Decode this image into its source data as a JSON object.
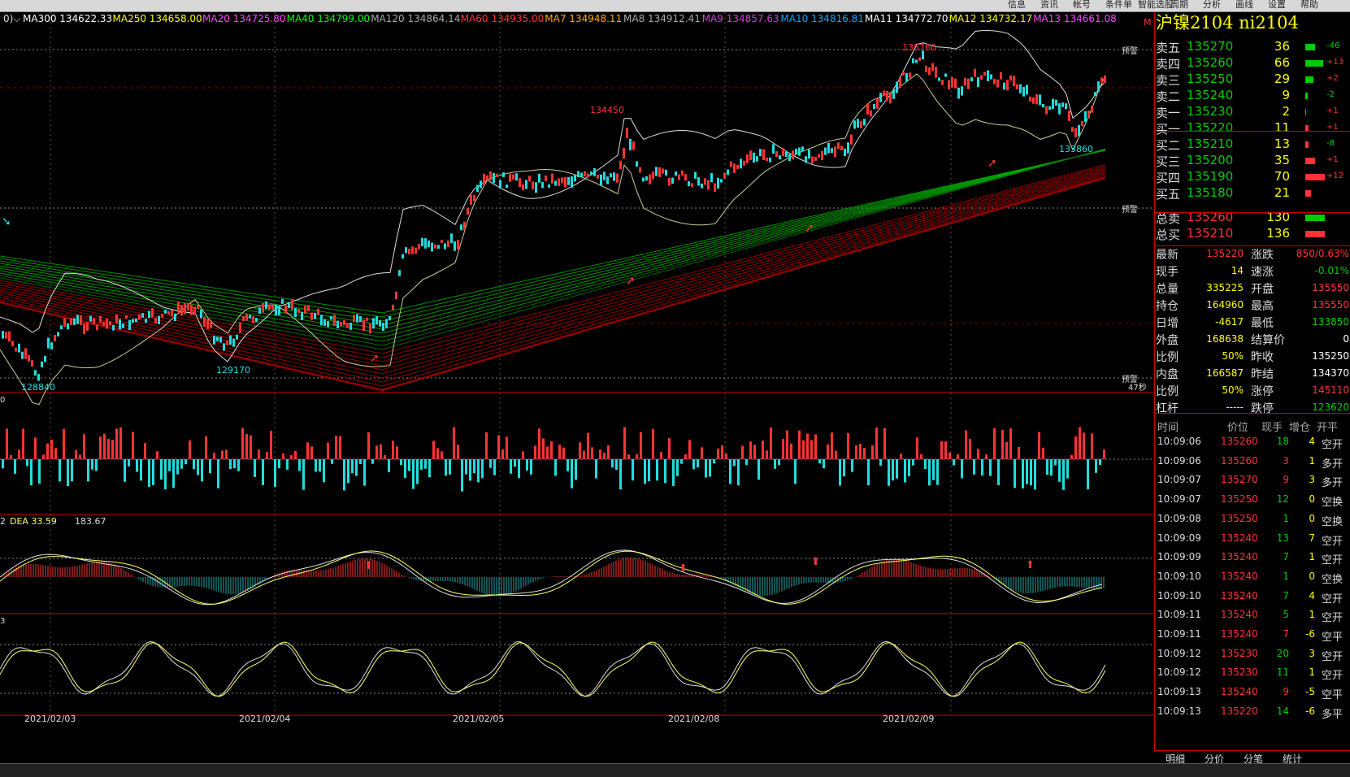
{
  "toolbar": {
    "items": [
      "信息",
      "资讯",
      "帐号",
      "条件单",
      "智能选股",
      "周期",
      "分析",
      "画线",
      "设置",
      "帮助"
    ]
  },
  "ma_legend": [
    {
      "label": "MA300 134622.33",
      "color": "#ffffff"
    },
    {
      "label": "MA250 134658.00",
      "color": "#ffff00"
    },
    {
      "label": "MA20 134725.80",
      "color": "#ff44ff"
    },
    {
      "label": "MA40 134799.00",
      "color": "#00ff00"
    },
    {
      "label": "MA120 134864.14",
      "color": "#aaaaaa"
    },
    {
      "label": "MA60 134935.00",
      "color": "#ff3333"
    },
    {
      "label": "MA7 134948.11",
      "color": "#ffaa00"
    },
    {
      "label": "MA8 134912.41",
      "color": "#aaaaaa"
    },
    {
      "label": "MA9 134857.63",
      "color": "#cc44cc"
    },
    {
      "label": "MA10 134816.81",
      "color": "#00aaff"
    },
    {
      "label": "MA11 134772.70",
      "color": "#ffffff"
    },
    {
      "label": "MA12 134732.17",
      "color": "#ffff00"
    },
    {
      "label": "MA13 134661.08",
      "color": "#ff44ff"
    }
  ],
  "price_labels": {
    "high": "135760",
    "p134450": "134450",
    "p133860": "133860",
    "p129170": "129170",
    "low": "128840"
  },
  "warn_label": "预警",
  "time_tag": "47秒",
  "macd_legend": {
    "dea": "DEA 33.59",
    "macd": "183.67"
  },
  "dates": [
    "2021/02/03",
    "2021/02/04",
    "2021/02/05",
    "2021/02/08",
    "2021/02/09"
  ],
  "symbol_title": "沪镍2104  ni2104",
  "orderbook": [
    {
      "label": "卖五",
      "price": "135270",
      "qty": "36",
      "chg": "-46",
      "side": "sell"
    },
    {
      "label": "卖四",
      "price": "135260",
      "qty": "66",
      "chg": "+13",
      "side": "sell"
    },
    {
      "label": "卖三",
      "price": "135250",
      "qty": "29",
      "chg": "+2",
      "side": "sell"
    },
    {
      "label": "卖二",
      "price": "135240",
      "qty": "9",
      "chg": "-2",
      "side": "sell"
    },
    {
      "label": "卖一",
      "price": "135230",
      "qty": "2",
      "chg": "+1",
      "side": "sell"
    },
    {
      "label": "买一",
      "price": "135220",
      "qty": "11",
      "chg": "+1",
      "side": "buy"
    },
    {
      "label": "买二",
      "price": "135210",
      "qty": "13",
      "chg": "-8",
      "side": "buy"
    },
    {
      "label": "买三",
      "price": "135200",
      "qty": "35",
      "chg": "+1",
      "side": "buy"
    },
    {
      "label": "买四",
      "price": "135190",
      "qty": "70",
      "chg": "+12",
      "side": "buy"
    },
    {
      "label": "买五",
      "price": "135180",
      "qty": "21",
      "chg": "",
      "side": "buy"
    }
  ],
  "totals": [
    {
      "label": "总卖",
      "price": "135260",
      "qty": "130",
      "color": "#00cc00"
    },
    {
      "label": "总买",
      "price": "135210",
      "qty": "136",
      "color": "#ff3333"
    }
  ],
  "stats": [
    {
      "l1": "最新",
      "v1": "135220",
      "c1": "#ff3333",
      "l2": "涨跌",
      "v2": "850/0.63%",
      "c2": "#ff3333"
    },
    {
      "l1": "现手",
      "v1": "14",
      "c1": "#ffff00",
      "l2": "速涨",
      "v2": "-0.01%",
      "c2": "#00cc00"
    },
    {
      "l1": "总量",
      "v1": "335225",
      "c1": "#ffff00",
      "l2": "开盘",
      "v2": "135550",
      "c2": "#ff3333"
    },
    {
      "l1": "持仓",
      "v1": "164960",
      "c1": "#ffff00",
      "l2": "最高",
      "v2": "135550",
      "c2": "#ff3333"
    },
    {
      "l1": "日增",
      "v1": "-4617",
      "c1": "#ffff00",
      "l2": "最低",
      "v2": "133850",
      "c2": "#00cc00"
    },
    {
      "l1": "外盘",
      "v1": "168638",
      "c1": "#ffff00",
      "l2": "结算价",
      "v2": "0",
      "c2": "#ffffff"
    },
    {
      "l1": "比例",
      "v1": "50%",
      "c1": "#ffff00",
      "l2": "昨收",
      "v2": "135250",
      "c2": "#ffffff"
    },
    {
      "l1": "内盘",
      "v1": "166587",
      "c1": "#ffff00",
      "l2": "昨结",
      "v2": "134370",
      "c2": "#ffffff"
    },
    {
      "l1": "比例",
      "v1": "50%",
      "c1": "#ffff00",
      "l2": "涨停",
      "v2": "145110",
      "c2": "#ff3333"
    },
    {
      "l1": "杠杆",
      "v1": "-----",
      "c1": "#ffff00",
      "l2": "跌停",
      "v2": "123620",
      "c2": "#00cc00"
    }
  ],
  "ticks_header": {
    "time": "时间",
    "price": "价位",
    "vol": "现手",
    "oi": "增仓",
    "kind": "开平"
  },
  "ticks": [
    {
      "time": "10:09:06",
      "price": "135260",
      "vol": "18",
      "oi": "4",
      "kind": "空开",
      "vc": "#00cc00"
    },
    {
      "time": "10:09:06",
      "price": "135260",
      "vol": "3",
      "oi": "1",
      "kind": "多开",
      "vc": "#ff3333"
    },
    {
      "time": "10:09:07",
      "price": "135270",
      "vol": "9",
      "oi": "3",
      "kind": "多开",
      "vc": "#ff3333"
    },
    {
      "time": "10:09:07",
      "price": "135250",
      "vol": "12",
      "oi": "0",
      "kind": "空换",
      "vc": "#00cc00"
    },
    {
      "time": "10:09:08",
      "price": "135250",
      "vol": "1",
      "oi": "0",
      "kind": "空换",
      "vc": "#00cc00"
    },
    {
      "time": "10:09:09",
      "price": "135240",
      "vol": "13",
      "oi": "7",
      "kind": "空开",
      "vc": "#00cc00"
    },
    {
      "time": "10:09:09",
      "price": "135240",
      "vol": "7",
      "oi": "1",
      "kind": "空开",
      "vc": "#00cc00"
    },
    {
      "time": "10:09:10",
      "price": "135240",
      "vol": "1",
      "oi": "0",
      "kind": "空换",
      "vc": "#00cc00"
    },
    {
      "time": "10:09:10",
      "price": "135240",
      "vol": "7",
      "oi": "4",
      "kind": "空开",
      "vc": "#00cc00"
    },
    {
      "time": "10:09:11",
      "price": "135240",
      "vol": "5",
      "oi": "1",
      "kind": "空开",
      "vc": "#00cc00"
    },
    {
      "time": "10:09:11",
      "price": "135240",
      "vol": "7",
      "oi": "-6",
      "kind": "空平",
      "vc": "#ff3333"
    },
    {
      "time": "10:09:12",
      "price": "135230",
      "vol": "20",
      "oi": "3",
      "kind": "空开",
      "vc": "#00cc00"
    },
    {
      "time": "10:09:12",
      "price": "135230",
      "vol": "11",
      "oi": "1",
      "kind": "空开",
      "vc": "#00cc00"
    },
    {
      "time": "10:09:13",
      "price": "135240",
      "vol": "9",
      "oi": "-5",
      "kind": "空平",
      "vc": "#ff3333"
    },
    {
      "time": "10:09:13",
      "price": "135220",
      "vol": "14",
      "oi": "-6",
      "kind": "多平",
      "vc": "#00cc00"
    }
  ],
  "bottom_tabs": [
    "明细",
    "分价",
    "分笔",
    "统计"
  ]
}
